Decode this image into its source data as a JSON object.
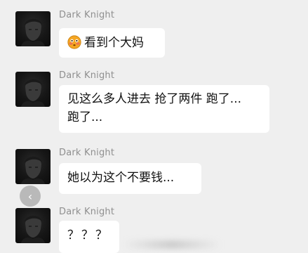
{
  "messages": [
    {
      "sender": "Dark Knight",
      "emoji": "flushed-face-emoji",
      "text": "看到个大妈"
    },
    {
      "sender": "Dark Knight",
      "lines": [
        "见这么多人进去 抢了两件 跑了...",
        "跑了..."
      ]
    },
    {
      "sender": "Dark Knight",
      "text": "她以为这个不要钱..."
    },
    {
      "sender": "Dark Knight",
      "text": "？？？"
    }
  ],
  "controls": {
    "back_icon": "chevron-left-icon",
    "back_glyph": "‹"
  },
  "colors": {
    "background": "#efefef",
    "bubble": "#ffffff",
    "sender_name": "#8f8f8f"
  }
}
